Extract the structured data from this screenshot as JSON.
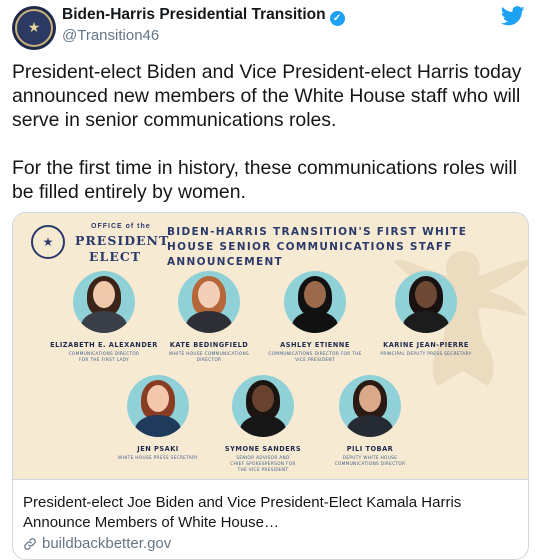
{
  "account": {
    "display_name": "Biden-Harris Presidential Transition",
    "handle": "@Transition46"
  },
  "tweet": {
    "paragraph_1": "President-elect Biden and Vice President-elect Harris today announced new members of the White House staff who will serve in senior communications roles.",
    "paragraph_2": "For the first time in history, these communications roles will be filled entirely by women."
  },
  "card": {
    "image": {
      "office_of": "OFFICE of the",
      "president": "PRESIDENT",
      "elect": "ELECT",
      "headline": "BIDEN-HARRIS TRANSITION'S FIRST WHITE HOUSE SENIOR COMMUNICATIONS STAFF ANNOUNCEMENT",
      "people": [
        {
          "name": "ELIZABETH E. ALEXANDER",
          "role": "COMMUNICATIONS DIRECTOR\nFOR THE FIRST LADY"
        },
        {
          "name": "KATE BEDINGFIELD",
          "role": "WHITE HOUSE COMMUNICATIONS\nDIRECTOR"
        },
        {
          "name": "ASHLEY ETIENNE",
          "role": "COMMUNICATIONS DIRECTOR FOR THE\nVICE PRESIDENT"
        },
        {
          "name": "KARINE JEAN-PIERRE",
          "role": "PRINCIPAL DEPUTY PRESS SECRETARY"
        },
        {
          "name": "JEN PSAKI",
          "role": "WHITE HOUSE PRESS SECRETARY"
        },
        {
          "name": "SYMONE SANDERS",
          "role": "SENIOR ADVISOR AND\nCHIEF SPOKESPERSON FOR\nTHE VICE PRESIDENT"
        },
        {
          "name": "PILI TOBAR",
          "role": "DEPUTY WHITE HOUSE\nCOMMUNICATIONS DIRECTOR"
        }
      ]
    },
    "title": "President-elect Joe Biden and Vice President-Elect Kamala Harris Announce Members of White House…",
    "link": "buildbackbetter.gov"
  },
  "colors": {
    "verified_blue": "#1da1f2",
    "card_background": "#f7ead3",
    "portrait_circle": "#8fd1d6",
    "navy": "#2b3a6b"
  },
  "icons": [
    "account-seal-icon",
    "verified-badge-icon",
    "twitter-bird-icon",
    "link-icon",
    "eagle-watermark-icon"
  ]
}
